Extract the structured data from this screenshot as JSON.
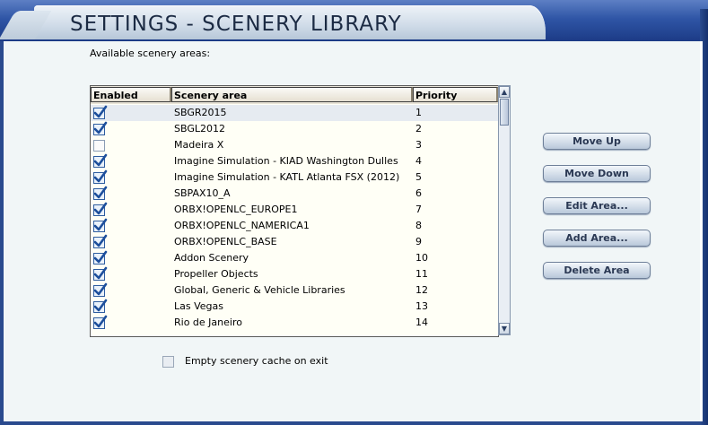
{
  "window": {
    "title": "SETTINGS - SCENERY LIBRARY"
  },
  "list_section": {
    "label": "Available scenery areas:",
    "columns": [
      "Enabled",
      "Scenery area",
      "Priority"
    ],
    "rows": [
      {
        "enabled": true,
        "name": "SBGR2015",
        "priority": "1"
      },
      {
        "enabled": true,
        "name": "SBGL2012",
        "priority": "2"
      },
      {
        "enabled": false,
        "name": "Madeira X",
        "priority": "3"
      },
      {
        "enabled": true,
        "name": "Imagine Simulation - KIAD Washington Dulles",
        "priority": "4"
      },
      {
        "enabled": true,
        "name": "Imagine Simulation - KATL Atlanta FSX (2012)",
        "priority": "5"
      },
      {
        "enabled": true,
        "name": "SBPAX10_A",
        "priority": "6"
      },
      {
        "enabled": true,
        "name": "ORBX!OPENLC_EUROPE1",
        "priority": "7"
      },
      {
        "enabled": true,
        "name": "ORBX!OPENLC_NAMERICA1",
        "priority": "8"
      },
      {
        "enabled": true,
        "name": "ORBX!OPENLC_BASE",
        "priority": "9"
      },
      {
        "enabled": true,
        "name": "Addon Scenery",
        "priority": "10"
      },
      {
        "enabled": true,
        "name": "Propeller Objects",
        "priority": "11"
      },
      {
        "enabled": true,
        "name": "Global, Generic & Vehicle Libraries",
        "priority": "12"
      },
      {
        "enabled": true,
        "name": "Las Vegas",
        "priority": "13"
      },
      {
        "enabled": true,
        "name": "Rio de Janeiro",
        "priority": "14"
      }
    ]
  },
  "actions": {
    "move_up": "Move Up",
    "move_down": "Move Down",
    "edit_area": "Edit Area...",
    "add_area": "Add Area...",
    "delete_area": "Delete Area"
  },
  "options": {
    "empty_cache_label": "Empty scenery cache on exit",
    "empty_cache_checked": false
  },
  "colors": {
    "header_blue": "#2f55a6",
    "panel_bg": "#f1f6f7",
    "list_bg": "#fffff6",
    "check_blue": "#1d4f9c"
  }
}
